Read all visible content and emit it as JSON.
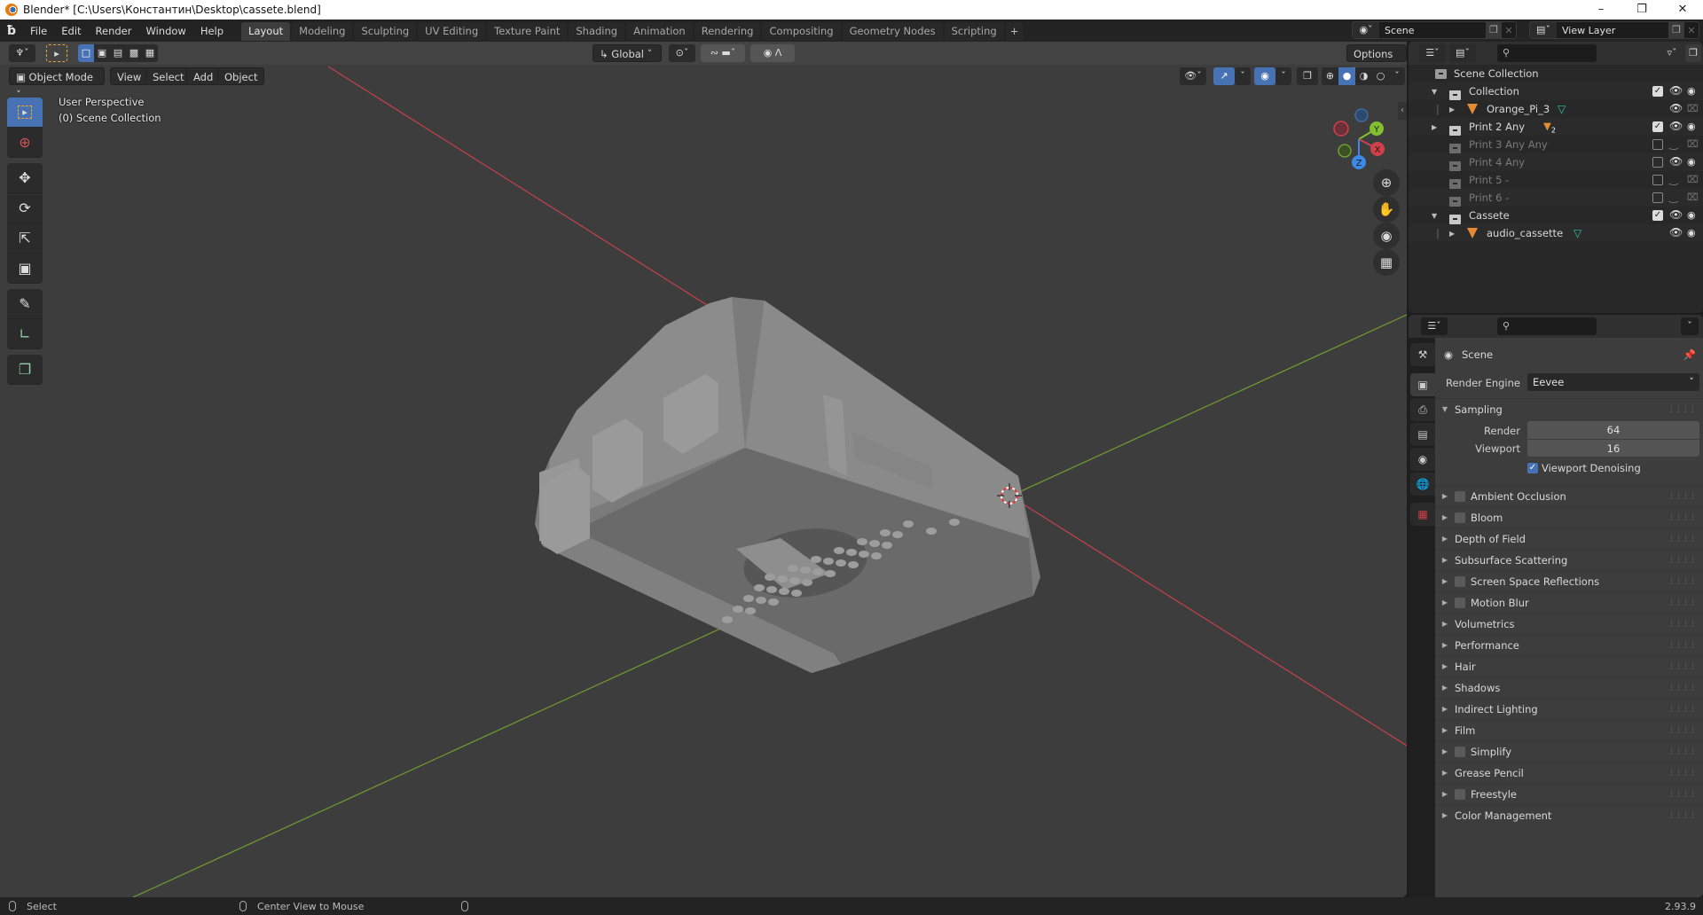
{
  "window": {
    "title": "Blender* [C:\\Users\\Константин\\Desktop\\cassete.blend]",
    "controls": [
      "minimize",
      "maximize",
      "close"
    ]
  },
  "menubar": {
    "items": [
      "File",
      "Edit",
      "Render",
      "Window",
      "Help"
    ]
  },
  "workspaces": {
    "tabs": [
      "Layout",
      "Modeling",
      "Sculpting",
      "UV Editing",
      "Texture Paint",
      "Shading",
      "Animation",
      "Rendering",
      "Compositing",
      "Geometry Nodes",
      "Scripting"
    ],
    "active": "Layout",
    "add_label": "+"
  },
  "scene_selector": {
    "value": "Scene"
  },
  "view_layer_selector": {
    "value": "View Layer"
  },
  "viewport": {
    "transform_orientation": "Global",
    "options_label": "Options",
    "mode": "Object Mode",
    "header_menus": [
      "View",
      "Select",
      "Add",
      "Object"
    ],
    "perspective_label": "User Perspective",
    "collection_label": "(0) Scene Collection",
    "shading_active": "solid",
    "gizmo_axes": [
      "X",
      "Y",
      "Z"
    ],
    "tools": [
      "select-box",
      "cursor",
      "move",
      "rotate",
      "scale",
      "transform",
      "annotate",
      "measure",
      "add-cube"
    ],
    "active_tool": "select-box",
    "colors": {
      "background": "#3d3d3d",
      "x_axis": "#d0404a",
      "y_axis": "#7ab23a",
      "accent": "#4772b3"
    }
  },
  "outliner": {
    "root": "Scene Collection",
    "rows": [
      {
        "name": "Collection",
        "type": "collection",
        "indent": 1,
        "expanded": true,
        "checked": true,
        "visible": true,
        "renderable": true,
        "dim": false
      },
      {
        "name": "Orange_Pi_3",
        "type": "object",
        "indent": 2,
        "expanded": false,
        "checked": null,
        "visible": true,
        "renderable": false,
        "dim": false,
        "has_mesh": true
      },
      {
        "name": "Print 2 Any",
        "type": "collection",
        "indent": 1,
        "expanded": false,
        "checked": true,
        "visible": true,
        "renderable": true,
        "dim": false,
        "child_count": "2"
      },
      {
        "name": "Print 3 Any Any",
        "type": "collection",
        "indent": 1,
        "expanded": null,
        "checked": false,
        "visible": false,
        "renderable": false,
        "dim": true
      },
      {
        "name": "Print 4 Any",
        "type": "collection",
        "indent": 1,
        "expanded": null,
        "checked": false,
        "visible": true,
        "renderable": true,
        "dim": true
      },
      {
        "name": "Print 5 -",
        "type": "collection",
        "indent": 1,
        "expanded": null,
        "checked": false,
        "visible": false,
        "renderable": false,
        "dim": true
      },
      {
        "name": "Print 6 -",
        "type": "collection",
        "indent": 1,
        "expanded": null,
        "checked": false,
        "visible": false,
        "renderable": false,
        "dim": true
      },
      {
        "name": "Cassete",
        "type": "collection",
        "indent": 1,
        "expanded": true,
        "checked": true,
        "visible": true,
        "renderable": true,
        "dim": false
      },
      {
        "name": "audio_cassette",
        "type": "object",
        "indent": 2,
        "expanded": false,
        "checked": null,
        "visible": true,
        "renderable": true,
        "dim": false,
        "has_mesh": true
      }
    ]
  },
  "properties": {
    "context": "Scene",
    "render_engine_label": "Render Engine",
    "render_engine": "Eevee",
    "sampling": {
      "title": "Sampling",
      "render_label": "Render",
      "render_value": "64",
      "viewport_label": "Viewport",
      "viewport_value": "16",
      "denoise_label": "Viewport Denoising",
      "denoise_checked": true
    },
    "panels": [
      {
        "label": "Ambient Occlusion",
        "has_checkbox": true
      },
      {
        "label": "Bloom",
        "has_checkbox": true
      },
      {
        "label": "Depth of Field",
        "has_checkbox": false
      },
      {
        "label": "Subsurface Scattering",
        "has_checkbox": false
      },
      {
        "label": "Screen Space Reflections",
        "has_checkbox": true
      },
      {
        "label": "Motion Blur",
        "has_checkbox": true
      },
      {
        "label": "Volumetrics",
        "has_checkbox": false
      },
      {
        "label": "Performance",
        "has_checkbox": false
      },
      {
        "label": "Hair",
        "has_checkbox": false
      },
      {
        "label": "Shadows",
        "has_checkbox": false
      },
      {
        "label": "Indirect Lighting",
        "has_checkbox": false
      },
      {
        "label": "Film",
        "has_checkbox": false
      },
      {
        "label": "Simplify",
        "has_checkbox": true
      },
      {
        "label": "Grease Pencil",
        "has_checkbox": false
      },
      {
        "label": "Freestyle",
        "has_checkbox": true
      },
      {
        "label": "Color Management",
        "has_checkbox": false
      }
    ],
    "tabs": [
      "tool",
      "render",
      "output",
      "view-layer",
      "scene",
      "world",
      "texture"
    ],
    "active_tab": "render"
  },
  "statusbar": {
    "left_action": "Select",
    "middle_action": "Center View to Mouse",
    "version": "2.93.9"
  }
}
